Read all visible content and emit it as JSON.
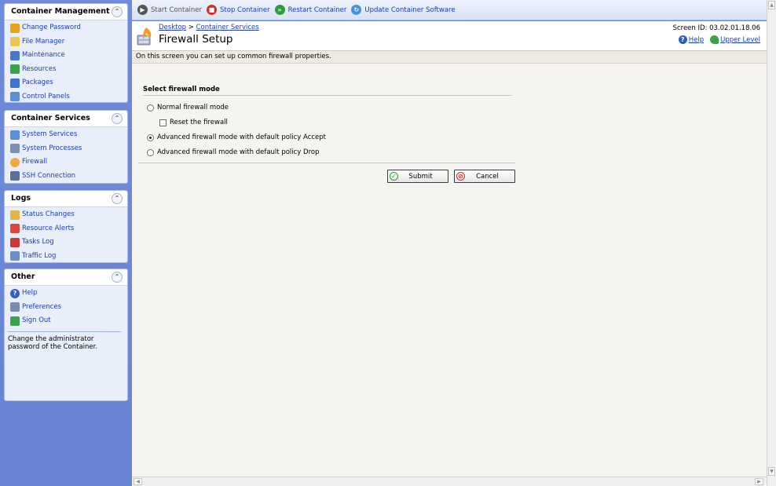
{
  "sidebar": {
    "panels": [
      {
        "title": "Container Management",
        "items": [
          {
            "label": "Change Password",
            "icon": "key-icon",
            "color": "#e8a21a"
          },
          {
            "label": "File Manager",
            "icon": "folder-icon",
            "color": "#f0c64a"
          },
          {
            "label": "Maintenance",
            "icon": "maintenance-icon",
            "color": "#4a78c8"
          },
          {
            "label": "Resources",
            "icon": "resources-icon",
            "color": "#3aa24a"
          },
          {
            "label": "Packages",
            "icon": "packages-icon",
            "color": "#3f73c9"
          },
          {
            "label": "Control Panels",
            "icon": "control-panels-icon",
            "color": "#5a8fd8"
          }
        ]
      },
      {
        "title": "Container Services",
        "items": [
          {
            "label": "System Services",
            "icon": "system-services-icon",
            "color": "#5a8fd8"
          },
          {
            "label": "System Processes",
            "icon": "system-processes-icon",
            "color": "#7d8fb0"
          },
          {
            "label": "Firewall",
            "icon": "firewall-icon",
            "color": "#f0a83c"
          },
          {
            "label": "SSH Connection",
            "icon": "ssh-icon",
            "color": "#5b6f9a"
          }
        ]
      },
      {
        "title": "Logs",
        "items": [
          {
            "label": "Status Changes",
            "icon": "status-changes-icon",
            "color": "#e0b64a"
          },
          {
            "label": "Resource Alerts",
            "icon": "resource-alerts-icon",
            "color": "#d94a3a"
          },
          {
            "label": "Tasks Log",
            "icon": "tasks-log-icon",
            "color": "#c83a3a"
          },
          {
            "label": "Traffic Log",
            "icon": "traffic-log-icon",
            "color": "#6a8fc0"
          }
        ]
      },
      {
        "title": "Other",
        "items": [
          {
            "label": "Help",
            "icon": "help-icon",
            "color": "#2f5fc4"
          },
          {
            "label": "Preferences",
            "icon": "preferences-icon",
            "color": "#7a8ab0"
          },
          {
            "label": "Sign Out",
            "icon": "sign-out-icon",
            "color": "#3aa24a"
          }
        ],
        "description": "Change the administrator password of the Container."
      }
    ]
  },
  "toolbar": {
    "start": "Start Container",
    "stop": "Stop Container",
    "restart": "Restart Container",
    "update": "Update Container Software"
  },
  "header": {
    "breadcrumb": [
      "Desktop",
      "Container Services"
    ],
    "breadcrumb_sep": ">",
    "title": "Firewall Setup",
    "screen_id": "Screen ID: 03.02.01.18.06",
    "help": "Help",
    "upper_level": "Upper Level"
  },
  "description": "On this screen you can set up common firewall properties.",
  "form": {
    "title": "Select firewall mode",
    "options": [
      {
        "label": "Normal firewall mode",
        "checked": false
      },
      {
        "label": "Reset the firewall",
        "checked": false
      },
      {
        "label": "Advanced firewall mode with default policy Accept",
        "checked": true
      },
      {
        "label": "Advanced firewall mode with default policy Drop",
        "checked": false
      }
    ],
    "submit": "Submit",
    "cancel": "Cancel"
  },
  "colors": {
    "sidebar_bg": "#6b86d6",
    "link": "#1c3bb8",
    "stop_red": "#d42a2a",
    "restart_green": "#2f9e3a"
  }
}
